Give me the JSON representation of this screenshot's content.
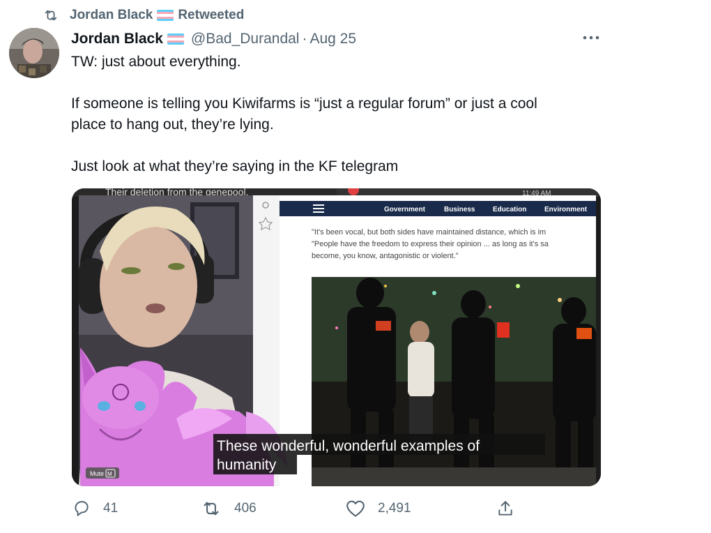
{
  "retweet_header": {
    "icon": "retweet-icon",
    "name": "Jordan Black",
    "label": "Retweeted"
  },
  "tweet": {
    "author_name": "Jordan Black",
    "handle": "@Bad_Durandal",
    "separator": "·",
    "date": "Aug 25",
    "more_icon": "more-icon",
    "text": "TW: just about everything.\n\nIf someone is telling you Kiwifarms is “just a regular forum” or just a cool\nplace to hang out, they’re lying.\n\nJust look at what they’re saying in the KF telegram"
  },
  "media": {
    "top_caption": "Their deletion from the genepool.",
    "time": "11:49 AM",
    "nav_items": [
      "Government",
      "Business",
      "Education",
      "Environment"
    ],
    "article_quote": "\"It's been vocal, but both sides have maintained distance, which is im\n\"People have the freedom to express their opinion ... as long as it's sa\nbecome, you know, antagonistic or violent.\"",
    "subtitle_line1": "These wonderful, wonderful examples of",
    "subtitle_line2": "humanity",
    "mute_label": "Mute",
    "mute_key": "M"
  },
  "actions": {
    "replies": "41",
    "retweets": "406",
    "likes": "2,491"
  },
  "colors": {
    "flag_blue": "#5bcefa",
    "flag_pink": "#f5a9b8",
    "flag_white": "#ffffff",
    "muted_text": "#536471",
    "primary_text": "#0f1419"
  }
}
